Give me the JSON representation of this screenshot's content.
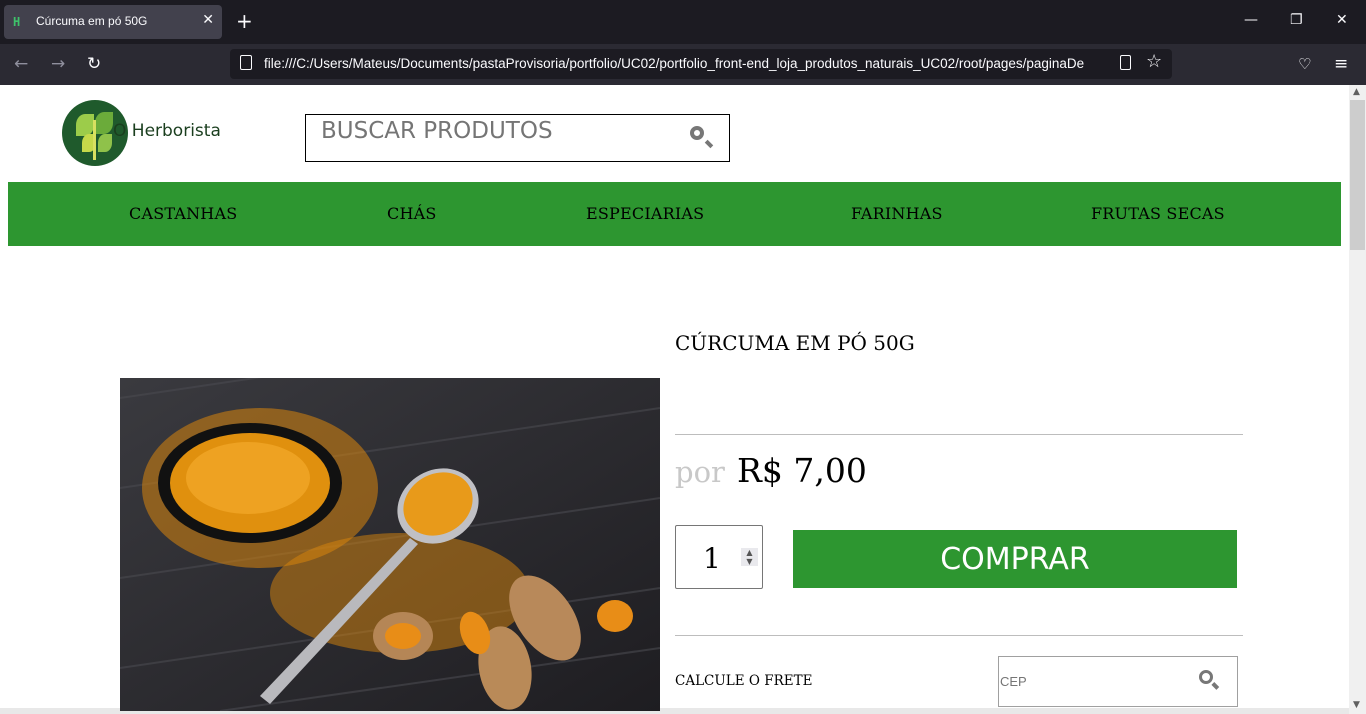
{
  "browser": {
    "tab_title": "Cúrcuma em pó 50G",
    "url": "file:///C:/Users/Mateus/Documents/pastaProvisoria/portfolio/UC02/portfolio_front-end_loja_produtos_naturais_UC02/root/pages/paginaDe",
    "favicon_text": "H"
  },
  "site": {
    "logo_text": "O Herborista",
    "search_placeholder": "BUSCAR PRODUTOS"
  },
  "menu": {
    "items": [
      "CASTANHAS",
      "CHÁS",
      "ESPECIARIAS",
      "FARINHAS",
      "FRUTAS SECAS"
    ]
  },
  "product": {
    "title": "CÚRCUMA EM PÓ 50G",
    "price_prefix": "por",
    "price": "R$ 7,00",
    "quantity": "1",
    "buy_label": "COMPRAR",
    "shipping_label": "CALCULE O FRETE",
    "cep_placeholder": "CEP"
  },
  "colors": {
    "brand_green": "#2d9630",
    "browser_dark": "#1c1b22"
  }
}
